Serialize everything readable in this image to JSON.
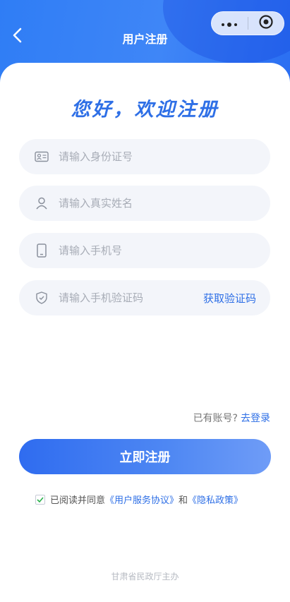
{
  "nav": {
    "title": "用户注册"
  },
  "colors": {
    "primary": "#2e6fe6",
    "header_start": "#2f7df5",
    "field_bg": "#f3f5fa"
  },
  "welcome": "您好，欢迎注册",
  "fields": [
    {
      "icon": "id-card-icon",
      "placeholder": "请输入身份证号"
    },
    {
      "icon": "user-icon",
      "placeholder": "请输入真实姓名"
    },
    {
      "icon": "phone-icon",
      "placeholder": "请输入手机号"
    },
    {
      "icon": "shield-icon",
      "placeholder": "请输入手机验证码"
    }
  ],
  "get_code_label": "获取验证码",
  "login": {
    "prefix": "已有账号?",
    "link": "去登录"
  },
  "register_button": "立即注册",
  "agreement": {
    "checked": true,
    "prefix": "已阅读并同意",
    "service_link": "《用户服务协议》",
    "and": "和",
    "privacy_link": "《隐私政策》"
  },
  "footer": "甘肃省民政厅主办"
}
